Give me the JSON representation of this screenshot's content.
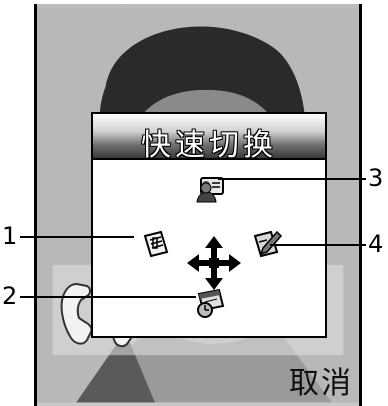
{
  "popup": {
    "title": "快速切换"
  },
  "softkeys": {
    "right_label": "取消"
  },
  "shortcuts": [
    {
      "callout": "1",
      "icon": "notepad-icon",
      "direction": "left"
    },
    {
      "callout": "2",
      "icon": "calendar-clock-icon",
      "direction": "down"
    },
    {
      "callout": "3",
      "icon": "contact-card-icon",
      "direction": "up"
    },
    {
      "callout": "4",
      "icon": "write-message-icon",
      "direction": "right"
    }
  ],
  "navigation": {
    "icon": "four-way-arrows-icon"
  }
}
